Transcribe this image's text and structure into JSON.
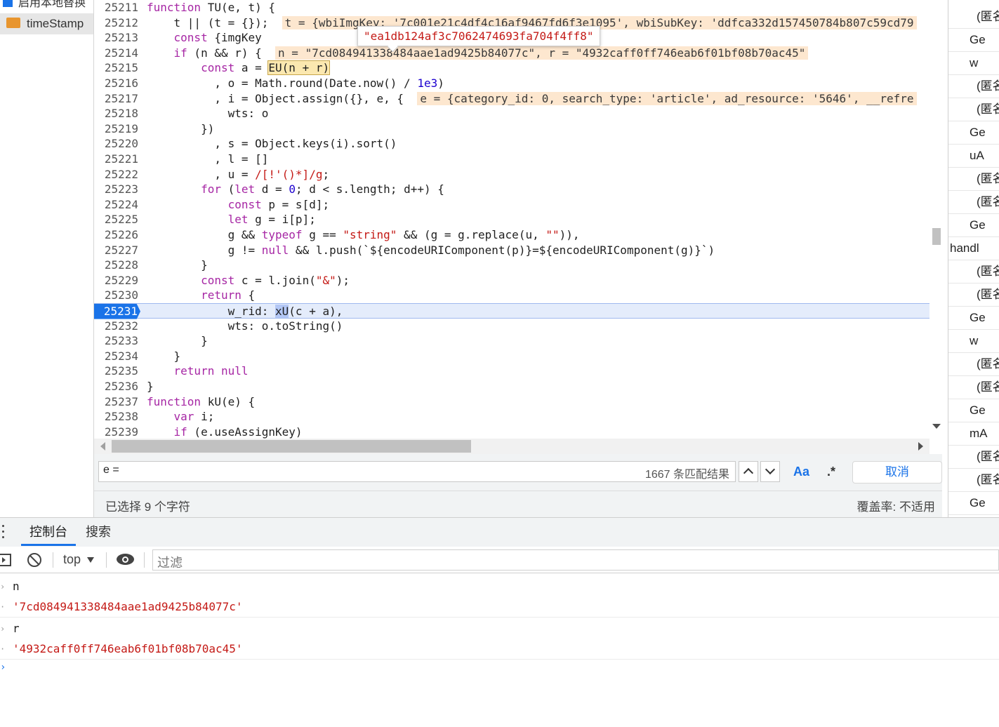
{
  "file_tree": {
    "top_item_partial": "启用本地替换",
    "file_item": "timeStamp"
  },
  "editor": {
    "lines": [
      {
        "n": "25211"
      },
      {
        "n": "25212"
      },
      {
        "n": "25213"
      },
      {
        "n": "25214"
      },
      {
        "n": "25215"
      },
      {
        "n": "25216"
      },
      {
        "n": "25217"
      },
      {
        "n": "25218"
      },
      {
        "n": "25219"
      },
      {
        "n": "25220"
      },
      {
        "n": "25221"
      },
      {
        "n": "25222"
      },
      {
        "n": "25223"
      },
      {
        "n": "25224"
      },
      {
        "n": "25225"
      },
      {
        "n": "25226"
      },
      {
        "n": "25227"
      },
      {
        "n": "25228"
      },
      {
        "n": "25229"
      },
      {
        "n": "25230"
      },
      {
        "n": "25231"
      },
      {
        "n": "25232"
      },
      {
        "n": "25233"
      },
      {
        "n": "25234"
      },
      {
        "n": "25235"
      },
      {
        "n": "25236"
      },
      {
        "n": "25237"
      },
      {
        "n": "25238"
      },
      {
        "n": "25239"
      }
    ],
    "active_line": "25231",
    "tooltip": "\"ea1db124af3c7062474693fa704f4ff8\"",
    "inline_values": {
      "line_25212": "t = {wbiImgKey: '7c001e21c4df4c16af9467fd6f3e1095', wbiSubKey: 'ddfca332d157450784b807c59cd79",
      "line_25214": "n = \"7cd084941338484aae1ad9425b84077c\", r = \"4932caff0ff746eab6f01bf08b70ac45\"",
      "line_25217": "e = {category_id: 0, search_type: 'article', ad_resource: '5646', __refre"
    }
  },
  "search": {
    "query": "e =",
    "match_count": "1667 条匹配结果",
    "case_label": "Aa",
    "regex_label": ".*",
    "cancel_label": "取消"
  },
  "status": {
    "selection": "已选择 9 个字符",
    "coverage": "覆盖率: 不适用"
  },
  "call_stack": [
    {
      "label": "(匿名",
      "kind": "anon"
    },
    {
      "label": "Ge",
      "kind": "frame"
    },
    {
      "label": "w",
      "kind": "frame"
    },
    {
      "label": "(匿名",
      "kind": "anon"
    },
    {
      "label": "(匿名",
      "kind": "anon"
    },
    {
      "label": "Ge",
      "kind": "frame"
    },
    {
      "label": "uA",
      "kind": "frame"
    },
    {
      "label": "(匿名",
      "kind": "anon"
    },
    {
      "label": "(匿名",
      "kind": "anon"
    },
    {
      "label": "Ge",
      "kind": "frame"
    },
    {
      "label": "handl",
      "kind": "frame"
    },
    {
      "label": "(匿名",
      "kind": "anon"
    },
    {
      "label": "(匿名",
      "kind": "anon"
    },
    {
      "label": "Ge",
      "kind": "frame"
    },
    {
      "label": "w",
      "kind": "frame"
    },
    {
      "label": "(匿名",
      "kind": "anon"
    },
    {
      "label": "(匿名",
      "kind": "anon"
    },
    {
      "label": "Ge",
      "kind": "frame"
    },
    {
      "label": "mA",
      "kind": "frame"
    },
    {
      "label": "(匿名",
      "kind": "anon"
    },
    {
      "label": "(匿名",
      "kind": "anon"
    },
    {
      "label": "Ge",
      "kind": "frame"
    }
  ],
  "drawer": {
    "tabs": [
      "控制台",
      "搜索"
    ],
    "context": "top",
    "filter_placeholder": "过滤"
  },
  "console": {
    "entries": [
      {
        "type": "input",
        "text": "n"
      },
      {
        "type": "result",
        "text": "'7cd084941338484aae1ad9425b84077c'"
      },
      {
        "type": "input",
        "text": "r"
      },
      {
        "type": "result",
        "text": "'4932caff0ff746eab6f01bf08b70ac45'"
      }
    ]
  },
  "colors": {
    "accent": "#1a73e8",
    "string": "#c41a16",
    "keyword": "#a626a4",
    "active_line_bg": "#e4ecfb",
    "inline_value_bg": "#fde7cf"
  }
}
